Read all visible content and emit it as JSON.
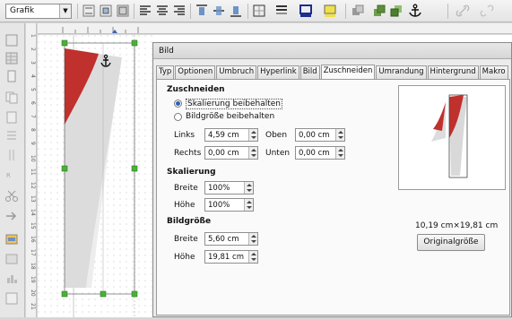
{
  "toolbar": {
    "style_value": "Grafik",
    "icons": [
      "wrap-off-icon",
      "wrap-page-icon",
      "wrap-optimal-icon",
      "align-left-icon",
      "align-center-icon",
      "align-right-icon",
      "align-top-icon",
      "align-middle-icon",
      "align-bottom-icon",
      "borders-icon",
      "border-style-icon",
      "border-color-icon",
      "background-color-icon",
      "arrange-icon",
      "bring-forward-icon",
      "send-backward-icon",
      "anchor-icon",
      "link-icon"
    ]
  },
  "ruler": {
    "vertical_marks": [
      "1",
      "2",
      "3",
      "4",
      "5",
      "6",
      "7",
      "8",
      "9",
      "10",
      "11",
      "12",
      "13",
      "14",
      "15",
      "16",
      "17",
      "18",
      "19",
      "20",
      "21"
    ]
  },
  "dialog": {
    "title": "Bild",
    "tabs": [
      "Typ",
      "Optionen",
      "Umbruch",
      "Hyperlink",
      "Bild",
      "Zuschneiden",
      "Umrandung",
      "Hintergrund",
      "Makro"
    ],
    "active_tab": "Zuschneiden",
    "crop": {
      "heading": "Zuschneiden",
      "keep_scale": "Skalierung beibehalten",
      "keep_size": "Bildgröße beibehalten",
      "left_label": "Links",
      "left_value": "4,59 cm",
      "right_label": "Rechts",
      "right_value": "0,00 cm",
      "top_label": "Oben",
      "top_value": "0,00 cm",
      "bottom_label": "Unten",
      "bottom_value": "0,00 cm"
    },
    "scale": {
      "heading": "Skalierung",
      "width_label": "Breite",
      "width_value": "100%",
      "height_label": "Höhe",
      "height_value": "100%"
    },
    "size": {
      "heading": "Bildgröße",
      "width_label": "Breite",
      "width_value": "5,60 cm",
      "height_label": "Höhe",
      "height_value": "19,81 cm"
    },
    "original_size_text": "10,19 cm×19,81 cm",
    "original_size_button": "Originalgröße"
  },
  "colors": {
    "accent_red": "#c0302d",
    "selection_green": "#4caf3a"
  }
}
